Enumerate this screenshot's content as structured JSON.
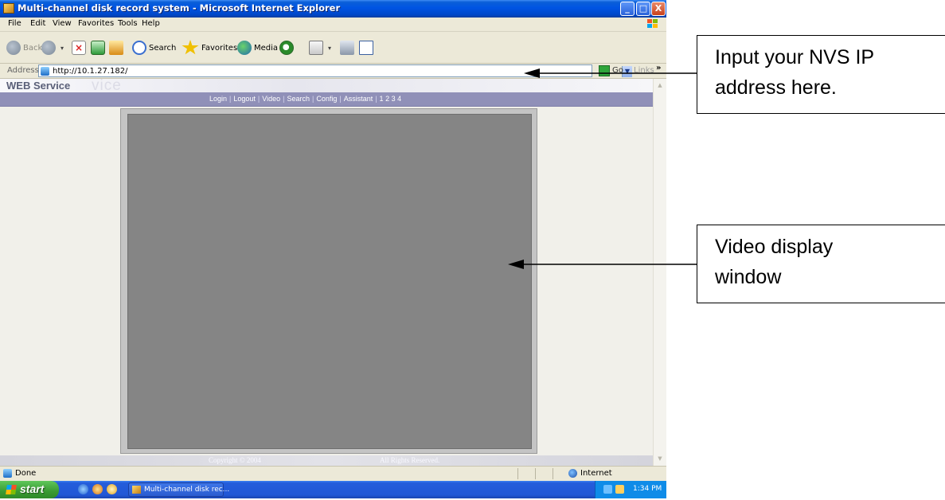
{
  "window": {
    "title": "Multi-channel disk record system - Microsoft Internet Explorer",
    "buttons": {
      "minimize": "_",
      "maximize": "□",
      "close": "X"
    }
  },
  "menu": [
    "File",
    "Edit",
    "View",
    "Favorites",
    "Tools",
    "Help"
  ],
  "toolbar": {
    "back": "Back",
    "search": "Search",
    "favorites": "Favorites",
    "media": "Media"
  },
  "address": {
    "label": "Address",
    "url": "http://10.1.27.182/",
    "go": "Go",
    "links": "Links",
    "chevron": "»"
  },
  "page": {
    "header_title": "WEB Service",
    "header_ghost": "vice",
    "nav": [
      "Login",
      "Logout",
      "Video",
      "Search",
      "Config",
      "Assistant",
      "1",
      "2",
      "3",
      "4"
    ],
    "footer_copyright": "Copyright © 2004",
    "footer_rights": "All Rights Reserved."
  },
  "status": {
    "text": "Done",
    "zone": "Internet"
  },
  "taskbar": {
    "start": "start",
    "item": "Multi-channel disk rec...",
    "clock": "1:34 PM"
  },
  "annotations": {
    "ip": [
      "Input your NVS IP",
      "address here."
    ],
    "video": [
      "Video display",
      "window"
    ]
  }
}
